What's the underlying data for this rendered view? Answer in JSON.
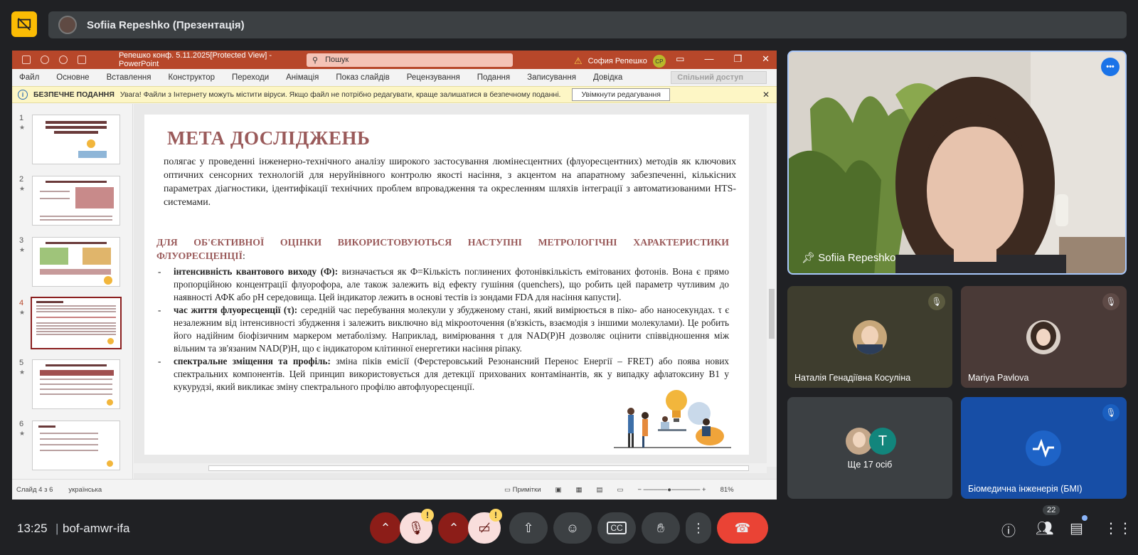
{
  "top_bar": {
    "presenter_title": "Sofiia Repeshko (Презентація)"
  },
  "ppt": {
    "doc_title": "Репешко конф. 5.11.2025[Protected View] - PowerPoint",
    "search_placeholder": "Пошук",
    "user_name": "София Репешко",
    "user_initials": "СР",
    "menu": [
      "Файл",
      "Основне",
      "Вставлення",
      "Конструктор",
      "Переходи",
      "Анімація",
      "Показ слайдів",
      "Рецензування",
      "Подання",
      "Записування",
      "Довідка"
    ],
    "share_label": "Спільний доступ",
    "infobar": {
      "title": "БЕЗПЕЧНЕ ПОДАННЯ",
      "message": "Увага! Файли з Інтернету можуть містити віруси. Якщо файл не потрібно редагувати, краще залишатися в безпечному поданні.",
      "button": "Увімкнути редагування"
    },
    "thumbnails": [
      "1",
      "2",
      "3",
      "4",
      "5",
      "6"
    ],
    "slide": {
      "title": "МЕТА ДОСЛІДЖЕНЬ",
      "paragraph": "полягає у проведенні інженерно-технічного аналізу широкого застосування люмінесцентних (флуоресцентних) методів як ключових оптичних сенсорних технологій для неруйнівного контролю якості насіння, з акцентом на апаратному забезпеченні, кількісних параметрах діагностики, ідентифікації технічних проблем впровадження та окресленням шляхів інтеграції з автоматизованими HTS-системами.",
      "subheading": "ДЛЯ ОБ'ЄКТИВНОЇ ОЦІНКИ ВИКОРИСТОВУЮТЬСЯ НАСТУПНІ МЕТРОЛОГІЧНІ ХАРАКТЕРИСТИКИ ФЛУОРЕСЦЕНЦІЇ",
      "subheading_colon": ":",
      "items": [
        {
          "term": "інтенсивність квантового виходу (Ф):",
          "text": " визначається як Ф=Кількість поглинених фотонівкількість емітованих фотонів. Вона є прямо пропорційною концентрації флуорофора, але також залежить від ефекту гушіння (quenchers), що робить цей параметр чутливим до наявності АФК або pH середовища. Цей індикатор лежить в основі тестів із зондами FDA для насіння капусти]."
        },
        {
          "term": "час життя флуоресценції (τ):",
          "text": " середній час перебування молекули у збудженому стані, який вимірюється в піко- або наносекундах. τ є незалежним від інтенсивності збудження і залежить виключно від мікрооточення (в'язкість, взаємодія з іншими молекулами). Це робить його надійним біофізичним маркером метаболізму. Наприклад, вимірювання τ для NAD(P)H дозволяє оцінити співвідношення між вільним та зв'язаним NAD(P)H, що є індикатором клітинної енергетики насіння ріпаку."
        },
        {
          "term": "спектральне зміщення та профіль:",
          "text": " зміна піків емісії (Ферстеровський Резонансний Перенос Енергії – FRET) або поява нових спектральних компонентів. Цей принцип використовується для детекції прихованих контамінантів, як у випадку афлатоксину B1 у кукурудзі, який викликає зміну спектрального профілю автофлуоресценції."
        }
      ]
    },
    "status": {
      "slide_info": "Слайд 4 з 6",
      "language": "українська",
      "notes": "Примітки",
      "zoom": "81%"
    }
  },
  "participants": {
    "main": "Sofiia Repeshko",
    "tile2": "Наталія Генадіївна Косуліна",
    "tile3": "Mariya Pavlova",
    "tile4_more": "Ще 17 осіб",
    "tile4_initial": "T",
    "tile5": "Біомедична інженерія (БМІ)"
  },
  "bottom": {
    "time": "13:25",
    "meeting_code": "bof-amwr-ifa",
    "people_count": "22",
    "badge": "!"
  },
  "colors": {
    "ppt_red": "#b7472a",
    "accent_blue": "#a8c7fa",
    "end_call": "#ea4335",
    "muted_red": "#8c1d18"
  }
}
